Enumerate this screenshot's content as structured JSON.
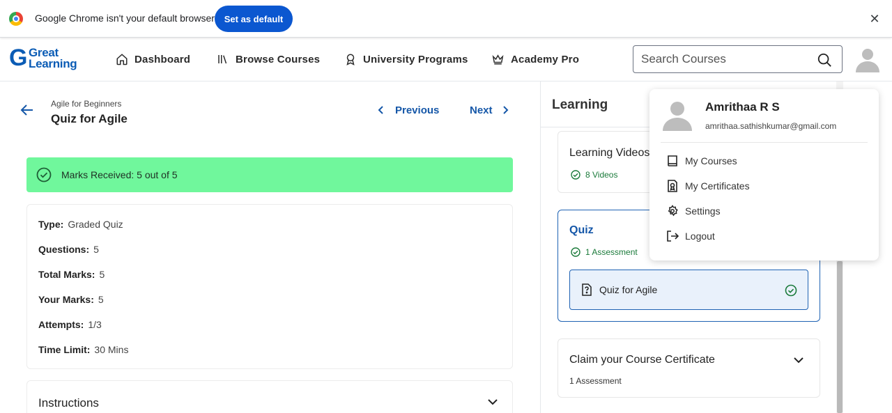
{
  "browser": {
    "infobar_text": "Google Chrome isn't your default browser",
    "set_default_label": "Set as default",
    "close_label": "✕"
  },
  "header": {
    "logo_line1": "Great",
    "logo_line2": "Learning",
    "nav": [
      {
        "label": "Dashboard",
        "icon": "home-icon"
      },
      {
        "label": "Browse Courses",
        "icon": "library-icon"
      },
      {
        "label": "University Programs",
        "icon": "award-icon"
      },
      {
        "label": "Academy Pro",
        "icon": "crown-icon"
      }
    ],
    "search_placeholder": "Search Courses"
  },
  "quiz": {
    "course_name": "Agile for Beginners",
    "title": "Quiz for Agile",
    "previous_label": "Previous",
    "next_label": "Next",
    "marks_banner": "Marks Received: 5 out of 5",
    "details": [
      {
        "label": "Type:",
        "value": "Graded Quiz"
      },
      {
        "label": "Questions:",
        "value": "5"
      },
      {
        "label": "Total Marks:",
        "value": "5"
      },
      {
        "label": "Your Marks:",
        "value": "5"
      },
      {
        "label": "Attempts:",
        "value": "1/3"
      },
      {
        "label": "Time Limit:",
        "value": "30 Mins"
      }
    ],
    "instructions_title": "Instructions"
  },
  "sidebar": {
    "title": "Learning",
    "sections": [
      {
        "title": "Learning Videos",
        "subtitle": "8 Videos"
      },
      {
        "title": "Quiz",
        "subtitle": "1 Assessment",
        "item": "Quiz for Agile"
      },
      {
        "title": "Claim your Course Certificate",
        "subtitle": "1 Assessment"
      }
    ]
  },
  "profile_menu": {
    "name": "Amrithaa R S",
    "email": "amrithaa.sathishkumar@gmail.com",
    "items": [
      {
        "label": "My Courses",
        "icon": "book-icon"
      },
      {
        "label": "My Certificates",
        "icon": "certificate-icon"
      },
      {
        "label": "Settings",
        "icon": "gear-icon"
      },
      {
        "label": "Logout",
        "icon": "logout-icon"
      }
    ]
  },
  "colors": {
    "brand_blue": "#1557a8",
    "success_green": "#70f79c",
    "chrome_button": "#0b57d0"
  }
}
